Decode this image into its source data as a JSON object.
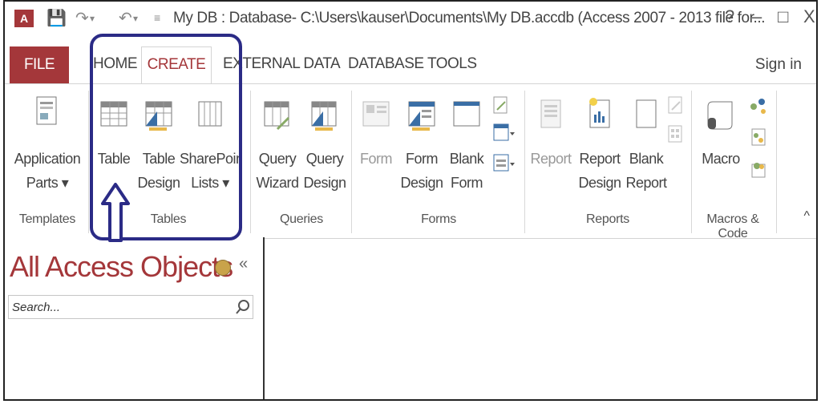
{
  "window": {
    "app_icon": "A",
    "title": "My DB : Database- C:\\Users\\kauser\\Documents\\My DB.accdb (Access 2007 - 2013 file for...",
    "help": "?",
    "minimize": "–",
    "maximize": "□",
    "close": "X"
  },
  "tabs": [
    {
      "label": "FILE"
    },
    {
      "label": "HOME"
    },
    {
      "label": "CREATE"
    },
    {
      "label": "EXTERNAL DATA"
    },
    {
      "label": "DATABASE TOOLS"
    }
  ],
  "sign_in": "Sign in",
  "ribbon": {
    "groups": {
      "templates": "Templates",
      "tables": "Tables",
      "queries": "Queries",
      "forms": "Forms",
      "reports": "Reports",
      "macros": "Macros & Code"
    },
    "buttons": {
      "app_parts": [
        "Application",
        "Parts ▾"
      ],
      "table": [
        "Table"
      ],
      "table_design": [
        "Table",
        "Design"
      ],
      "sharepoint": [
        "SharePoint",
        "Lists ▾"
      ],
      "query_wizard": [
        "Query",
        "Wizard"
      ],
      "query_design": [
        "Query",
        "Design"
      ],
      "form": [
        "Form"
      ],
      "form_design": [
        "Form",
        "Design"
      ],
      "blank_form": [
        "Blank",
        "Form"
      ],
      "report": [
        "Report"
      ],
      "report_design": [
        "Report",
        "Design"
      ],
      "blank_report": [
        "Blank",
        "Report"
      ],
      "macro": [
        "Macro"
      ]
    },
    "collapse": "^"
  },
  "nav_pane": {
    "title": "All Access Objects",
    "collapse": "«",
    "search_placeholder": "Search..."
  },
  "colors": {
    "accent": "#a4373a",
    "highlight": "#2b2b86"
  }
}
